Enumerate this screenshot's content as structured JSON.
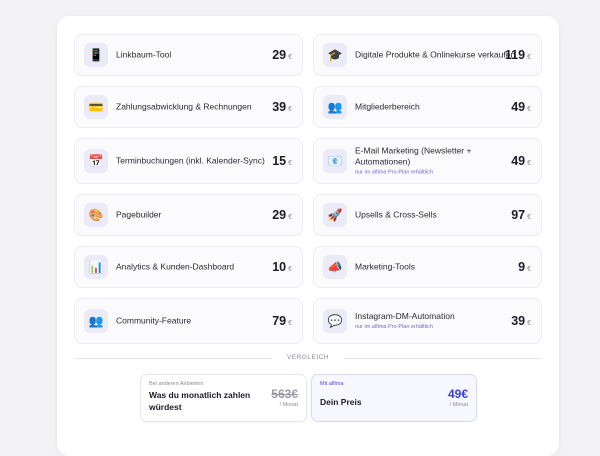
{
  "features": [
    {
      "icon": "phone-icon",
      "glyph": "📱",
      "label": "Linkbaum-Tool",
      "price": "29",
      "currency": "€"
    },
    {
      "icon": "graduation-cap-icon",
      "glyph": "🎓",
      "label": "Digitale Produkte & Onlinekurse verkaufen",
      "price": "119",
      "currency": "€"
    },
    {
      "icon": "credit-card-icon",
      "glyph": "💳",
      "label": "Zahlungsabwicklung & Rechnungen",
      "price": "39",
      "currency": "€"
    },
    {
      "icon": "members-icon",
      "glyph": "👥",
      "label": "Mitgliederbereich",
      "price": "49",
      "currency": "€"
    },
    {
      "icon": "calendar-icon",
      "glyph": "📅",
      "label": "Terminbuchungen (inkl. Kalender-Sync)",
      "price": "15",
      "currency": "€"
    },
    {
      "icon": "mail-icon",
      "glyph": "📧",
      "label": "E-Mail Marketing (Newsletter + Automationen)",
      "note": "nur im alfima Pro-Plan erhältlich",
      "price": "49",
      "currency": "€"
    },
    {
      "icon": "palette-icon",
      "glyph": "🎨",
      "label": "Pagebuilder",
      "price": "29",
      "currency": "€"
    },
    {
      "icon": "rocket-icon",
      "glyph": "🚀",
      "label": "Upsells & Cross-Sells",
      "price": "97",
      "currency": "€"
    },
    {
      "icon": "chart-icon",
      "glyph": "📊",
      "label": "Analytics & Kunden-Dashboard",
      "price": "10",
      "currency": "€"
    },
    {
      "icon": "megaphone-icon",
      "glyph": "📣",
      "label": "Marketing-Tools",
      "price": "9",
      "currency": "€"
    },
    {
      "icon": "community-icon",
      "glyph": "👥",
      "label": "Community-Feature",
      "price": "79",
      "currency": "€"
    },
    {
      "icon": "chat-bubble-icon",
      "glyph": "💬",
      "label": "Instagram-DM-Automation",
      "note": "nur im alfima Pro-Plan erhältlich",
      "price": "39",
      "currency": "€"
    }
  ],
  "divider_label": "VERGLEICH",
  "comparison": {
    "others": {
      "tag": "Bei anderen Anbietern",
      "question": "Was du monatlich zahlen würdest",
      "price": "563€",
      "per": "/ Monat"
    },
    "alfima": {
      "tag": "Mit alfima",
      "question": "Dein Preis",
      "price": "49€",
      "per": "/ Monat"
    }
  }
}
